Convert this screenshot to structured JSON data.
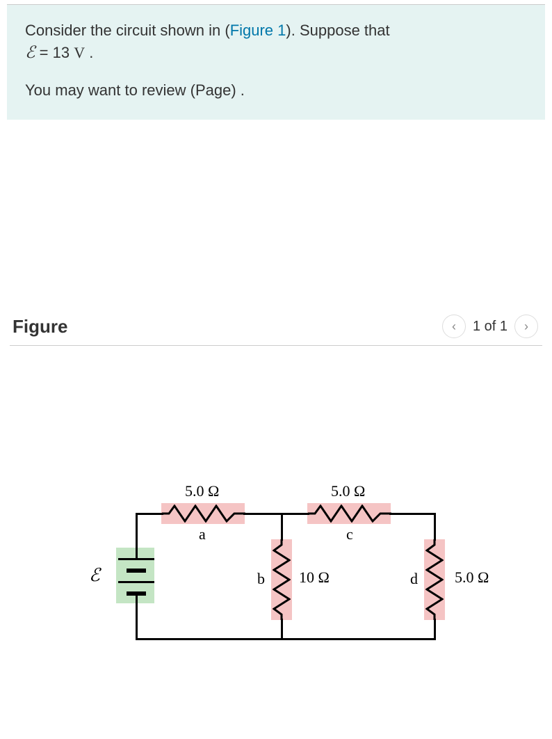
{
  "intro": {
    "text_before_link": "Consider the circuit shown in (",
    "figure_link": "Figure 1",
    "text_after_link": "). Suppose that ",
    "emf_symbol": "ℰ",
    "equals": " = 13 ",
    "unit": "V",
    "period": " .",
    "review_text": "You may want to review (Page) ."
  },
  "figure": {
    "title": "Figure",
    "pager": "1 of 1"
  },
  "circuit": {
    "emf_label": "ℰ",
    "r_top_left": "5.0 Ω",
    "r_top_right": "5.0 Ω",
    "r_mid": "10 Ω",
    "r_right": "5.0 Ω",
    "node_a": "a",
    "node_b": "b",
    "node_c": "c",
    "node_d": "d"
  },
  "icons": {
    "prev": "‹",
    "next": "›"
  }
}
